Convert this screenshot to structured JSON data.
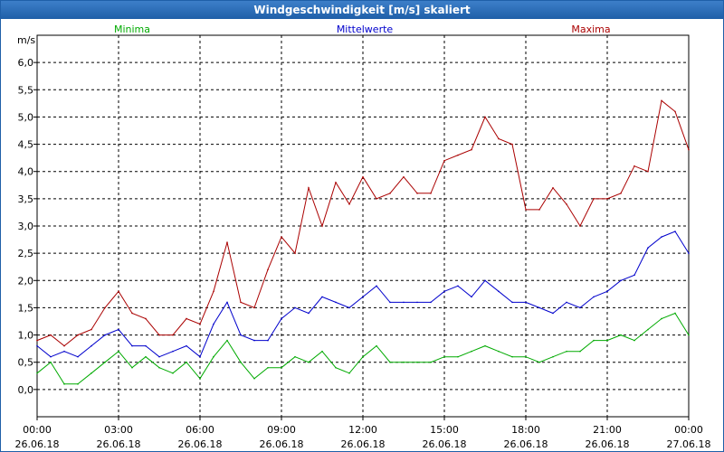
{
  "window": {
    "title": "Windgeschwindigkeit [m/s] skaliert"
  },
  "chart_data": {
    "type": "line",
    "title": "Windgeschwindigkeit [m/s] skaliert",
    "ylabel": "m/s",
    "ylim": [
      -0.5,
      6.5
    ],
    "xlim": [
      0,
      24
    ],
    "grid": true,
    "legend_placement": "top",
    "yticks": [
      0.0,
      0.5,
      1.0,
      1.5,
      2.0,
      2.5,
      3.0,
      3.5,
      4.0,
      4.5,
      5.0,
      5.5,
      6.0
    ],
    "ytick_labels": [
      "0,0",
      "0,5",
      "1,0",
      "1,5",
      "2,0",
      "2,5",
      "3,0",
      "3,5",
      "4,0",
      "4,5",
      "5,0",
      "5,5",
      "6,0"
    ],
    "xticks": [
      {
        "x": 0,
        "time": "00:00",
        "date": "26.06.18"
      },
      {
        "x": 3,
        "time": "03:00",
        "date": "26.06.18"
      },
      {
        "x": 6,
        "time": "06:00",
        "date": "26.06.18"
      },
      {
        "x": 9,
        "time": "09:00",
        "date": "26.06.18"
      },
      {
        "x": 12,
        "time": "12:00",
        "date": "26.06.18"
      },
      {
        "x": 15,
        "time": "15:00",
        "date": "26.06.18"
      },
      {
        "x": 18,
        "time": "18:00",
        "date": "26.06.18"
      },
      {
        "x": 21,
        "time": "21:00",
        "date": "26.06.18"
      },
      {
        "x": 24,
        "time": "00:00",
        "date": "27.06.18"
      }
    ],
    "series": [
      {
        "name": "Minima",
        "color": "#00aa00",
        "x": [
          0,
          0.5,
          1,
          1.5,
          2,
          2.5,
          3,
          3.5,
          4,
          4.5,
          5,
          5.5,
          6,
          6.5,
          7,
          7.5,
          8,
          8.5,
          9,
          9.5,
          10,
          10.5,
          11,
          11.5,
          12,
          12.5,
          13,
          13.5,
          14,
          14.5,
          15,
          15.5,
          16,
          16.5,
          17,
          17.5,
          18,
          18.5,
          19,
          19.5,
          20,
          20.5,
          21,
          21.5,
          22,
          22.5,
          23,
          23.5,
          24
        ],
        "values": [
          0.3,
          0.5,
          0.1,
          0.1,
          0.3,
          0.5,
          0.7,
          0.4,
          0.6,
          0.4,
          0.3,
          0.5,
          0.2,
          0.6,
          0.9,
          0.5,
          0.2,
          0.4,
          0.4,
          0.6,
          0.5,
          0.7,
          0.4,
          0.3,
          0.6,
          0.8,
          0.5,
          0.5,
          0.5,
          0.5,
          0.6,
          0.6,
          0.7,
          0.8,
          0.7,
          0.6,
          0.6,
          0.5,
          0.6,
          0.7,
          0.7,
          0.9,
          0.9,
          1.0,
          0.9,
          1.1,
          1.3,
          1.4,
          1.0
        ]
      },
      {
        "name": "Mittelwerte",
        "color": "#0000cc",
        "x": [
          0,
          0.5,
          1,
          1.5,
          2,
          2.5,
          3,
          3.5,
          4,
          4.5,
          5,
          5.5,
          6,
          6.5,
          7,
          7.5,
          8,
          8.5,
          9,
          9.5,
          10,
          10.5,
          11,
          11.5,
          12,
          12.5,
          13,
          13.5,
          14,
          14.5,
          15,
          15.5,
          16,
          16.5,
          17,
          17.5,
          18,
          18.5,
          19,
          19.5,
          20,
          20.5,
          21,
          21.5,
          22,
          22.5,
          23,
          23.5,
          24
        ],
        "values": [
          0.8,
          0.6,
          0.7,
          0.6,
          0.8,
          1.0,
          1.1,
          0.8,
          0.8,
          0.6,
          0.7,
          0.8,
          0.6,
          1.2,
          1.6,
          1.0,
          0.9,
          0.9,
          1.3,
          1.5,
          1.4,
          1.7,
          1.6,
          1.5,
          1.7,
          1.9,
          1.6,
          1.6,
          1.6,
          1.6,
          1.8,
          1.9,
          1.7,
          2.0,
          1.8,
          1.6,
          1.6,
          1.5,
          1.4,
          1.6,
          1.5,
          1.7,
          1.8,
          2.0,
          2.1,
          2.6,
          2.8,
          2.9,
          2.5
        ]
      },
      {
        "name": "Maxima",
        "color": "#aa0000",
        "x": [
          0,
          0.5,
          1,
          1.5,
          2,
          2.5,
          3,
          3.5,
          4,
          4.5,
          5,
          5.5,
          6,
          6.5,
          7,
          7.5,
          8,
          8.5,
          9,
          9.5,
          10,
          10.5,
          11,
          11.5,
          12,
          12.5,
          13,
          13.5,
          14,
          14.5,
          15,
          15.5,
          16,
          16.5,
          17,
          17.5,
          18,
          18.5,
          19,
          19.5,
          20,
          20.5,
          21,
          21.5,
          22,
          22.5,
          23,
          23.5,
          24
        ],
        "values": [
          0.9,
          1.0,
          0.8,
          1.0,
          1.1,
          1.5,
          1.8,
          1.4,
          1.3,
          1.0,
          1.0,
          1.3,
          1.2,
          1.8,
          2.7,
          1.6,
          1.5,
          2.2,
          2.8,
          2.5,
          3.7,
          3.0,
          3.8,
          3.4,
          3.9,
          3.5,
          3.6,
          3.9,
          3.6,
          3.6,
          4.2,
          4.3,
          4.4,
          5.0,
          4.6,
          4.5,
          3.3,
          3.3,
          3.7,
          3.4,
          3.0,
          3.5,
          3.5,
          3.6,
          4.1,
          4.0,
          5.3,
          5.1,
          4.4
        ]
      }
    ]
  }
}
